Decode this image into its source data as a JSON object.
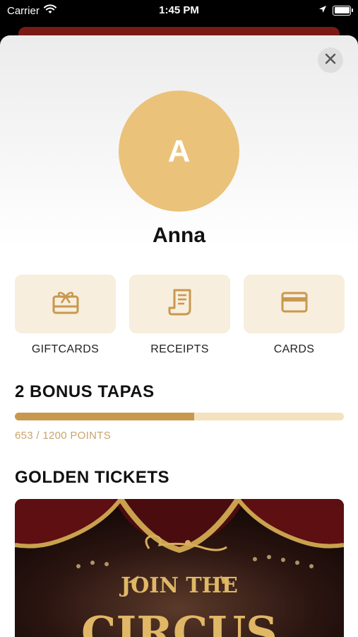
{
  "status_bar": {
    "carrier": "Carrier",
    "time": "1:45 PM"
  },
  "profile": {
    "avatar_initial": "A",
    "avatar_color": "#ebc27a",
    "name": "Anna"
  },
  "tiles": [
    {
      "label": "GIFTCARDS",
      "icon": "gift-card-icon"
    },
    {
      "label": "RECEIPTS",
      "icon": "receipt-icon"
    },
    {
      "label": "CARDS",
      "icon": "credit-card-icon"
    }
  ],
  "bonus": {
    "title": "2 BONUS TAPAS",
    "points": "653 / 1200 POINTS",
    "progress": 0.544
  },
  "tickets": {
    "title": "GOLDEN TICKETS",
    "card_text_line1": "JOIN THE",
    "card_text_line2": "CIRCUS"
  },
  "colors": {
    "accent": "#c9984f",
    "tile_bg": "#f7eedd",
    "progress_track": "#f4e1bd"
  }
}
